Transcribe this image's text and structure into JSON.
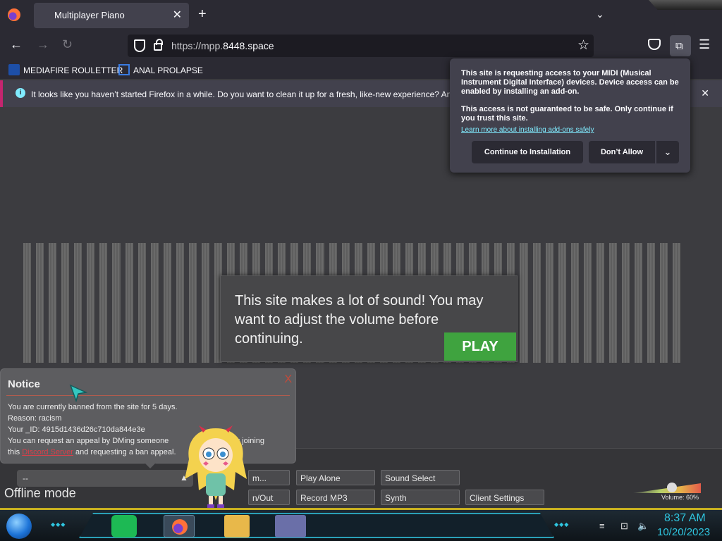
{
  "browser": {
    "tab_title": "Multiplayer Piano",
    "url_prefix": "https://mpp.",
    "url_domain": "8448.space",
    "bookmarks": [
      "MEDIAFIRE ROULETTER",
      "ANAL PROLAPSE"
    ],
    "infobar_text": "It looks like you haven’t started Firefox in a while. Do you want to clean it up for a fresh, like-new experience? And"
  },
  "midi_popup": {
    "para1": "This site is requesting access to your MIDI (Musical Instrument Digital Interface) devices. Device access can be enabled by installing an add-on.",
    "para2": "This access is not guaranteed to be safe. Only continue if you trust this site.",
    "link": "Learn more about installing add-ons safely",
    "continue_label": "Continue to Installation",
    "dont_allow_label": "Don’t Allow"
  },
  "sound_modal": {
    "text": "This site makes a lot of sound! You may want to adjust the volume before continuing.",
    "play_label": "PLAY"
  },
  "notice": {
    "title": "Notice",
    "close": "X",
    "line1": "You are currently banned from the site for 5 days.",
    "line2": "Reason: racism",
    "line3": "Your _ID: 4915d1436d26c710da844e3e",
    "line4a": "You can request an appeal by DMing someone",
    "line4b": "or joining",
    "line5a": "this",
    "line5_link": "Discord Server",
    "line5b": "and requesting a ban appeal."
  },
  "controls": {
    "chat_value": "--",
    "offline": "Offline mode",
    "room_btn": "m...",
    "inout_btn": "n/Out",
    "play_alone": "Play Alone",
    "sound_select": "Sound Select",
    "record_mp3": "Record MP3",
    "synth": "Synth",
    "client_settings": "Client Settings",
    "volume_label": "Volume: 60%",
    "volume_level": 0.6
  },
  "taskbar": {
    "time": "8:37 AM",
    "date": "10/20/2023"
  },
  "colors": {
    "play_green": "#3fa33f",
    "info_accent": "#c5256f",
    "link_cyan": "#80ebff",
    "clock_cyan": "#2fc6e0"
  }
}
